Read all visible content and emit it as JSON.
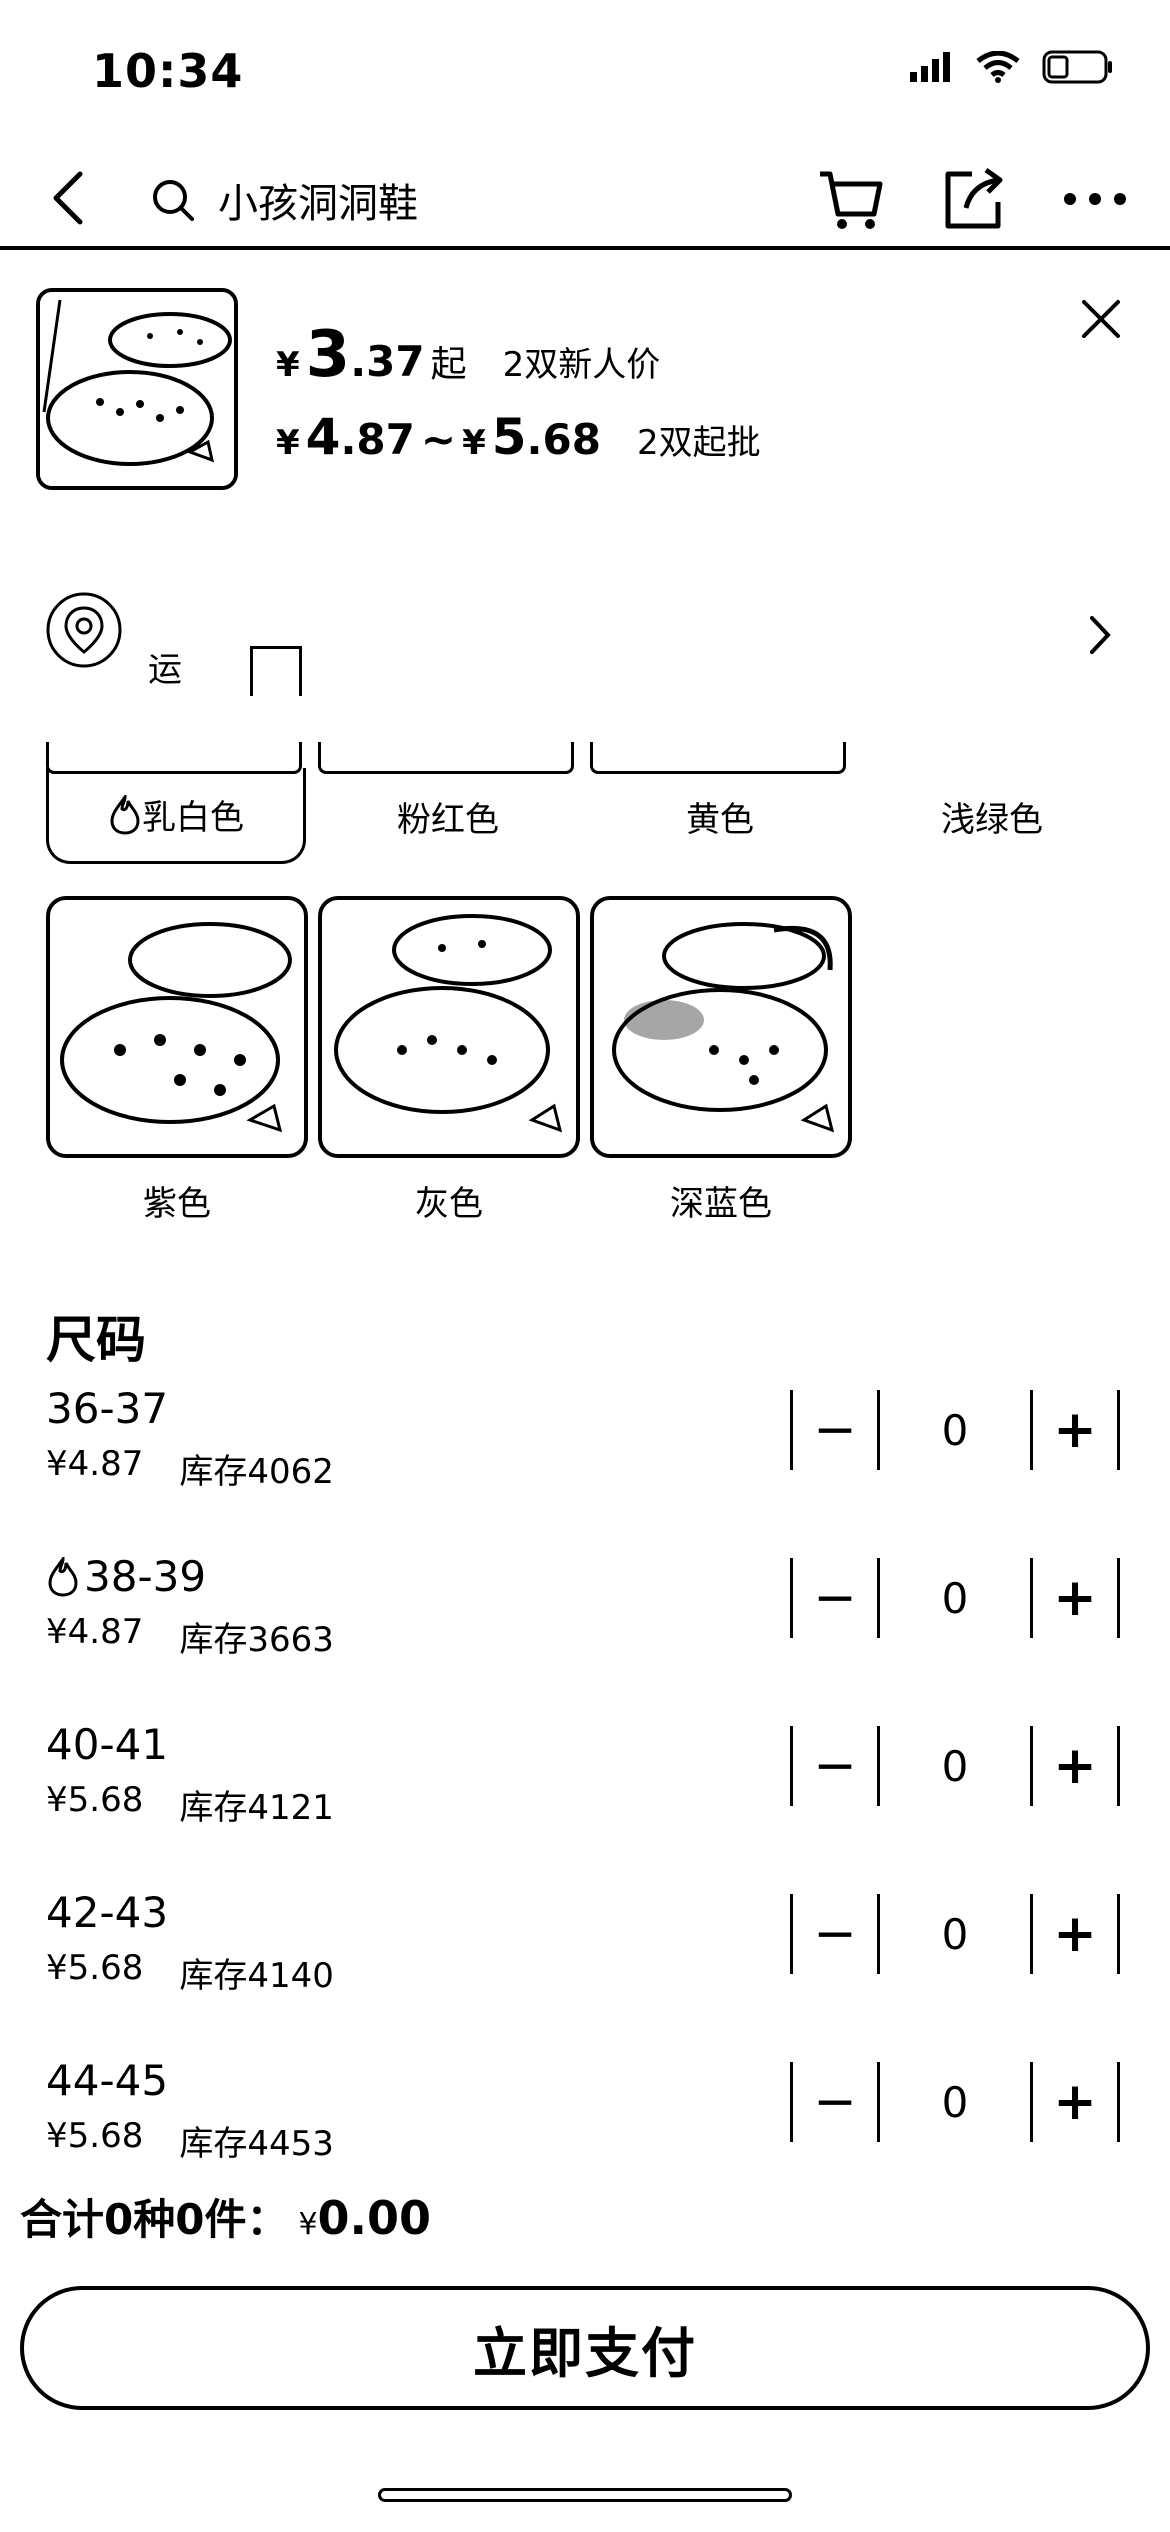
{
  "status": {
    "time": "10:34"
  },
  "nav": {
    "search_text": "小孩洞洞鞋"
  },
  "product": {
    "yen": "¥",
    "new_price_int": "3",
    "new_price_dec": ".37",
    "new_price_suffix": "起",
    "new_price_tag": "2双新人价",
    "range_low_int": "4",
    "range_low_dec": ".87",
    "range_sep": "~",
    "range_high_int": "5",
    "range_high_dec": ".68",
    "range_tag": "2双起批"
  },
  "address": {
    "text": "运"
  },
  "colors": {
    "tabs": [
      "乳白色",
      "粉红色",
      "黄色",
      "浅绿色"
    ],
    "cards": [
      "紫色",
      "灰色",
      "深蓝色"
    ]
  },
  "sizes": {
    "title": "尺码",
    "rows": [
      {
        "size": "36-37",
        "price": "¥4.87",
        "stock": "库存4062",
        "qty": "0",
        "hot": false
      },
      {
        "size": "38-39",
        "price": "¥4.87",
        "stock": "库存3663",
        "qty": "0",
        "hot": true
      },
      {
        "size": "40-41",
        "price": "¥5.68",
        "stock": "库存4121",
        "qty": "0",
        "hot": false
      },
      {
        "size": "42-43",
        "price": "¥5.68",
        "stock": "库存4140",
        "qty": "0",
        "hot": false
      },
      {
        "size": "44-45",
        "price": "¥5.68",
        "stock": "库存4453",
        "qty": "0",
        "hot": false
      }
    ]
  },
  "footer": {
    "total_label": "合计0种0件：",
    "currency": "¥",
    "total_amount": "0.00",
    "pay_label": "立即支付"
  }
}
